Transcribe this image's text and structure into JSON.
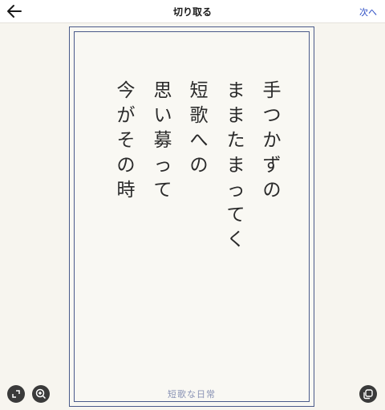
{
  "header": {
    "title": "切り取る",
    "next_label": "次へ",
    "back_icon": "arrow-left-icon"
  },
  "card": {
    "lines": [
      "手つかずの",
      "ままたまってく",
      "短歌への",
      "思い募って",
      "今がその時"
    ],
    "footer": "短歌な日常",
    "border_color": "#4a5a8a"
  },
  "controls": {
    "expand_icon": "expand-icon",
    "zoom_icon": "zoom-in-icon",
    "copy_icon": "copy-icon"
  }
}
